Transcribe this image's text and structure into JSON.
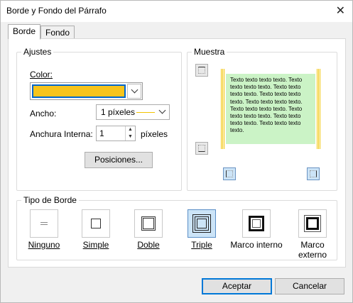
{
  "window": {
    "title": "Borde y Fondo del Párrafo",
    "close_glyph": "✕"
  },
  "tabs": [
    {
      "label": "Borde"
    },
    {
      "label": "Fondo"
    }
  ],
  "ajustes": {
    "legend": "Ajustes",
    "color_label": "Color:",
    "color_value": "#f7c41b",
    "ancho_label": "Ancho:",
    "ancho_value": "1 píxeles",
    "anchura_label": "Anchura Interna:",
    "anchura_value": "1",
    "anchura_unit": "píxeles",
    "posiciones_label": "Posiciones..."
  },
  "muestra": {
    "legend": "Muestra",
    "sample_text": "Texto texto texto texto. Texto texto texto texto. Texto texto texto texto. Texto texto texto texto. Texto texto texto texto. Texto texto texto texto. Texto texto texto texto. Texto texto texto texto. Texto texto texto texto."
  },
  "tipo_borde": {
    "legend": "Tipo de Borde",
    "items": [
      {
        "label": "Ninguno",
        "selected": false
      },
      {
        "label": "Simple",
        "selected": false
      },
      {
        "label": "Doble",
        "selected": false
      },
      {
        "label": "Triple",
        "selected": true
      },
      {
        "label": "Marco interno",
        "selected": false
      },
      {
        "label": "Marco externo",
        "selected": false
      }
    ]
  },
  "footer": {
    "accept_label": "Aceptar",
    "cancel_label": "Cancelar"
  },
  "colors": {
    "border_color": "#f7c41b",
    "preview_bg": "#cbf3c6",
    "accent": "#0078d7"
  }
}
